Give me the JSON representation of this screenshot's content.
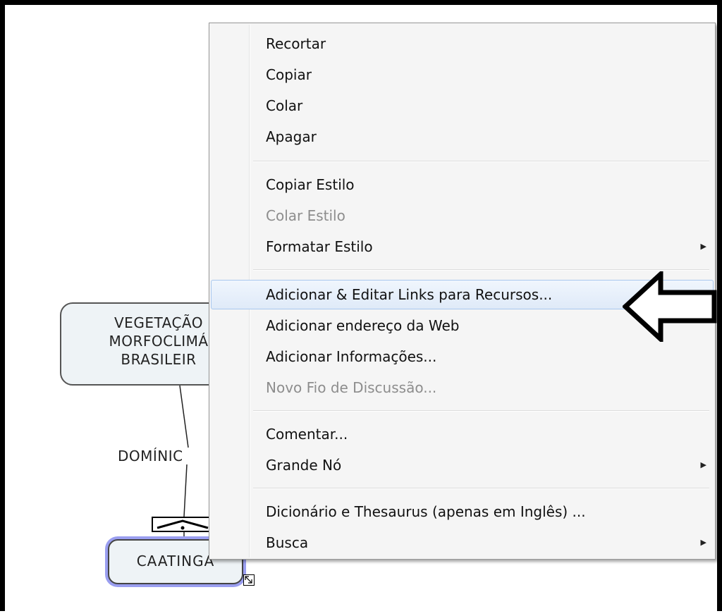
{
  "map": {
    "veg_node_lines": [
      "VEGETAÇÃO",
      "MORFOCLIMÁ",
      "BRASILEIR"
    ],
    "link_label": "DOMÍNIC",
    "caatinga_node": "CAATINGA"
  },
  "menu": {
    "items": [
      {
        "label": "Recortar",
        "disabled": false,
        "submenu": false,
        "highlighted": false
      },
      {
        "label": "Copiar",
        "disabled": false,
        "submenu": false,
        "highlighted": false
      },
      {
        "label": "Colar",
        "disabled": false,
        "submenu": false,
        "highlighted": false
      },
      {
        "label": "Apagar",
        "disabled": false,
        "submenu": false,
        "highlighted": false
      },
      {
        "label": "Copiar Estilo",
        "disabled": false,
        "submenu": false,
        "highlighted": false
      },
      {
        "label": "Colar Estilo",
        "disabled": true,
        "submenu": false,
        "highlighted": false
      },
      {
        "label": "Formatar Estilo",
        "disabled": false,
        "submenu": true,
        "highlighted": false
      },
      {
        "label": "Adicionar & Editar Links para Recursos...",
        "disabled": false,
        "submenu": false,
        "highlighted": true
      },
      {
        "label": "Adicionar endereço da Web",
        "disabled": false,
        "submenu": false,
        "highlighted": false
      },
      {
        "label": "Adicionar Informações...",
        "disabled": false,
        "submenu": false,
        "highlighted": false
      },
      {
        "label": "Novo Fio de Discussão...",
        "disabled": true,
        "submenu": false,
        "highlighted": false
      },
      {
        "label": "Comentar...",
        "disabled": false,
        "submenu": false,
        "highlighted": false
      },
      {
        "label": "Grande Nó",
        "disabled": false,
        "submenu": true,
        "highlighted": false
      },
      {
        "label": "Dicionário e Thesaurus (apenas em Inglês) ...",
        "disabled": false,
        "submenu": false,
        "highlighted": false
      },
      {
        "label": "Busca",
        "disabled": false,
        "submenu": true,
        "highlighted": false
      }
    ],
    "submenu_glyph": "▶"
  },
  "colors": {
    "highlight_border": "#a8c7ee",
    "caatinga_selection": "#9a9ef0",
    "disabled_text": "#8d8d8d"
  },
  "icons": {
    "callout": "hollow-arrow-left-icon",
    "resize": "resize-handle-icon"
  }
}
